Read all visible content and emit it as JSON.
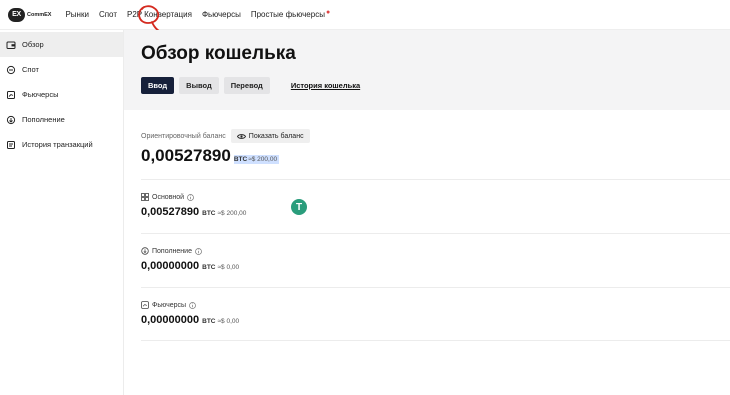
{
  "logo": {
    "mark": "EX",
    "text": "CommEX"
  },
  "nav": {
    "items": [
      {
        "label": "Рынки"
      },
      {
        "label": "Спот"
      },
      {
        "label": "P2P"
      },
      {
        "label": "Конвертация"
      },
      {
        "label": "Фьючерсы"
      },
      {
        "label": "Простые фьючерсы"
      }
    ],
    "new_marker": "●"
  },
  "sidebar": {
    "items": [
      {
        "label": "Обзор",
        "icon": "wallet-icon",
        "active": true
      },
      {
        "label": "Спот",
        "icon": "spot-icon"
      },
      {
        "label": "Фьючерсы",
        "icon": "futures-icon"
      },
      {
        "label": "Пополнение",
        "icon": "deposit-icon"
      },
      {
        "label": "История транзакций",
        "icon": "history-icon"
      }
    ]
  },
  "main": {
    "title": "Обзор кошелька",
    "tabs": [
      {
        "label": "Ввод",
        "active": true
      },
      {
        "label": "Вывод"
      },
      {
        "label": "Перевод"
      }
    ],
    "history_link": "История кошелька",
    "estimated_label": "Ориентировочный баланс",
    "show_balance_label": "Показать баланс",
    "total_value": "0,00527890",
    "total_unit": "BTC",
    "total_approx": "≈$ 200,00",
    "accounts": [
      {
        "name": "Основной",
        "icon": "main-account-icon",
        "value": "0,00527890",
        "unit": "BTC",
        "approx": "≈$ 200,00"
      },
      {
        "name": "Пополнение",
        "icon": "deposit-account-icon",
        "value": "0,00000000",
        "unit": "BTC",
        "approx": "≈$ 0,00"
      },
      {
        "name": "Фьючерсы",
        "icon": "futures-account-icon",
        "value": "0,00000000",
        "unit": "BTC",
        "approx": "≈$ 0,00"
      }
    ]
  },
  "colors": {
    "accent_dark": "#16203a",
    "tether": "#2a9d7c",
    "annotation": "#d42a1f",
    "highlight": "#cfe0ff"
  }
}
